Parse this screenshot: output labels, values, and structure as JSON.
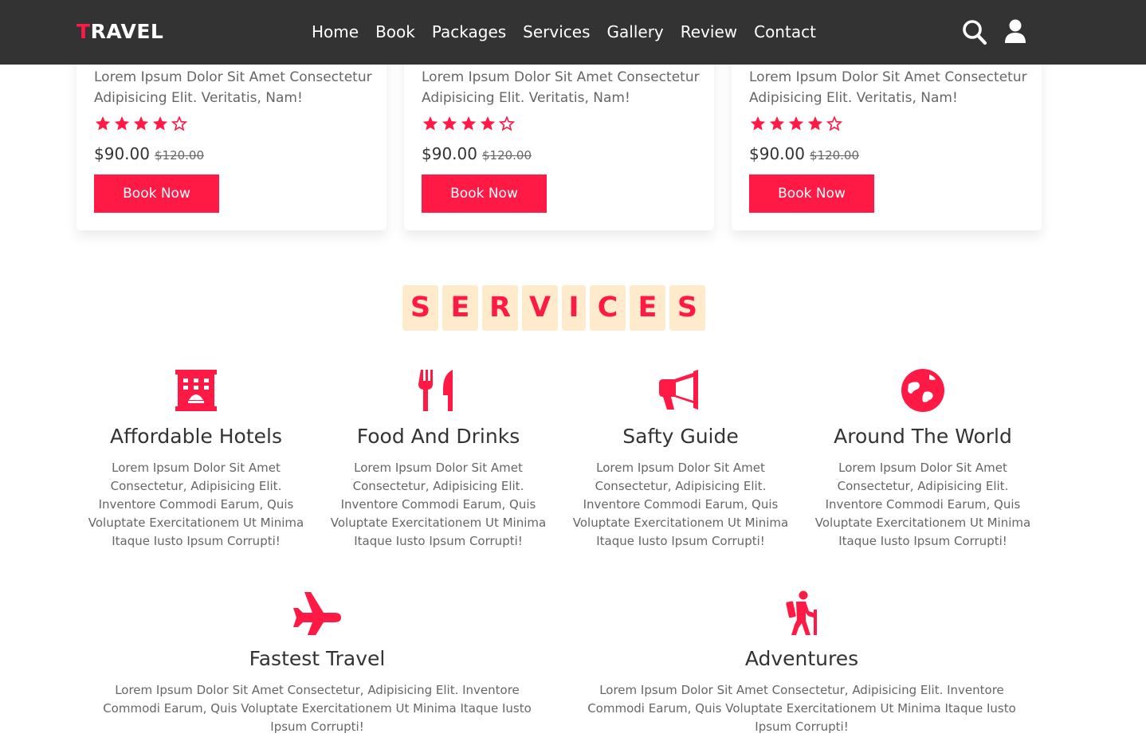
{
  "header": {
    "logo_accent": "T",
    "logo_rest": "RAVEL",
    "nav": [
      "Home",
      "Book",
      "Packages",
      "Services",
      "Gallery",
      "Review",
      "Contact"
    ],
    "icons": [
      "search-icon",
      "user-icon"
    ]
  },
  "packages": [
    {
      "desc": "Lorem Ipsum Dolor Sit Amet Consectetur Adipisicing Elit. Veritatis, Nam!",
      "rating": 4,
      "max_rating": 5,
      "price": "$90.00",
      "old_price": "$120.00",
      "button": "Book Now"
    },
    {
      "desc": "Lorem Ipsum Dolor Sit Amet Consectetur Adipisicing Elit. Veritatis, Nam!",
      "rating": 4,
      "max_rating": 5,
      "price": "$90.00",
      "old_price": "$120.00",
      "button": "Book Now"
    },
    {
      "desc": "Lorem Ipsum Dolor Sit Amet Consectetur Adipisicing Elit. Veritatis, Nam!",
      "rating": 4,
      "max_rating": 5,
      "price": "$90.00",
      "old_price": "$120.00",
      "button": "Book Now"
    }
  ],
  "services": {
    "heading_letters": [
      "S",
      "E",
      "R",
      "V",
      "I",
      "C",
      "E",
      "S"
    ],
    "items": [
      {
        "icon": "hotel-icon",
        "title": "Affordable Hotels",
        "text": "Lorem Ipsum Dolor Sit Amet Consectetur, Adipisicing Elit. Inventore Commodi Earum, Quis Voluptate Exercitationem Ut Minima Itaque Iusto Ipsum Corrupti!"
      },
      {
        "icon": "utensils-icon",
        "title": "Food And Drinks",
        "text": "Lorem Ipsum Dolor Sit Amet Consectetur, Adipisicing Elit. Inventore Commodi Earum, Quis Voluptate Exercitationem Ut Minima Itaque Iusto Ipsum Corrupti!"
      },
      {
        "icon": "bullhorn-icon",
        "title": "Safty Guide",
        "text": "Lorem Ipsum Dolor Sit Amet Consectetur, Adipisicing Elit. Inventore Commodi Earum, Quis Voluptate Exercitationem Ut Minima Itaque Iusto Ipsum Corrupti!"
      },
      {
        "icon": "globe-icon",
        "title": "Around The World",
        "text": "Lorem Ipsum Dolor Sit Amet Consectetur, Adipisicing Elit. Inventore Commodi Earum, Quis Voluptate Exercitationem Ut Minima Itaque Iusto Ipsum Corrupti!"
      },
      {
        "icon": "plane-icon",
        "title": "Fastest Travel",
        "text": "Lorem Ipsum Dolor Sit Amet Consectetur, Adipisicing Elit. Inventore Commodi Earum, Quis Voluptate Exercitationem Ut Minima Itaque Iusto Ipsum Corrupti!"
      },
      {
        "icon": "hiking-icon",
        "title": "Adventures",
        "text": "Lorem Ipsum Dolor Sit Amet Consectetur, Adipisicing Elit. Inventore Commodi Earum, Quis Voluptate Exercitationem Ut Minima Itaque Iusto Ipsum Corrupti!"
      }
    ]
  },
  "colors": {
    "accent": "#ff1a45",
    "header_bg": "#333333",
    "heading_tile": "#ffeacc",
    "text_muted": "#666666"
  }
}
